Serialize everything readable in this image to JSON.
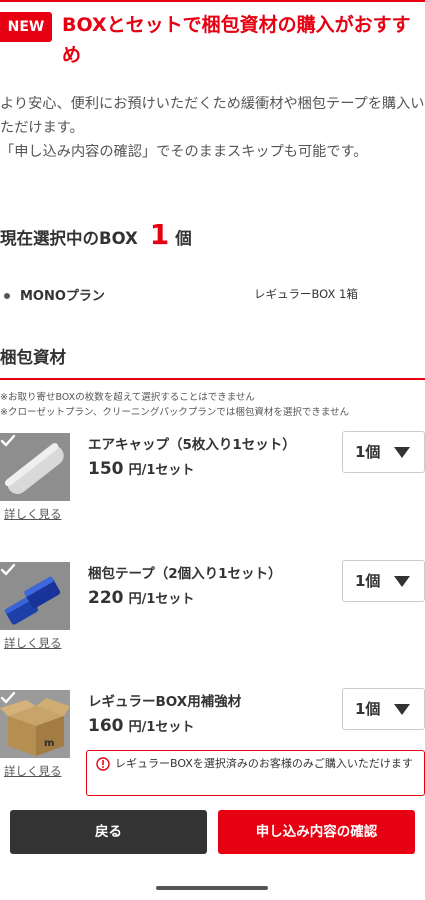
{
  "header": {
    "badge": "NEW",
    "headline": "BOXとセットで梱包資材の購入がおすすめ"
  },
  "intro": {
    "line1": "より安心、便利にお預けいただくため緩衝材や梱包テープを購入いただけます。",
    "line2": "「申し込み内容の確認」でそのままスキップも可能です。"
  },
  "selection": {
    "label": "現在選択中のBOX",
    "count": "1",
    "unit": "個"
  },
  "plan": {
    "name": "MONOプラン",
    "box": "レギュラーBOX 1箱"
  },
  "packing": {
    "title": "梱包資材",
    "notes": [
      "※お取り寄せBOXの枚数を超えて選択することはできません",
      "※クローゼットプラン、クリーニングパックプランでは梱包資材を選択できません"
    ],
    "items": [
      {
        "name": "エアキャップ（5枚入り1セット）",
        "price": "150",
        "price_unit": "円/1セット",
        "qty": "1個",
        "details": "詳しく見る",
        "icon": "bubble-wrap"
      },
      {
        "name": "梱包テープ（2個入り1セット）",
        "price": "220",
        "price_unit": "円/1セット",
        "qty": "1個",
        "details": "詳しく見る",
        "icon": "packing-tape"
      },
      {
        "name": "レギュラーBOX用補強材",
        "price": "160",
        "price_unit": "円/1セット",
        "qty": "1個",
        "details": "詳しく見る",
        "icon": "cardboard-box",
        "notice": "レギュラーBOXを選択済みのお客様のみご購入いただけます"
      }
    ]
  },
  "footer": {
    "back": "戻る",
    "confirm": "申し込み内容の確認"
  },
  "colors": {
    "accent": "#e60012",
    "text": "#333333",
    "back_button": "#333333"
  }
}
